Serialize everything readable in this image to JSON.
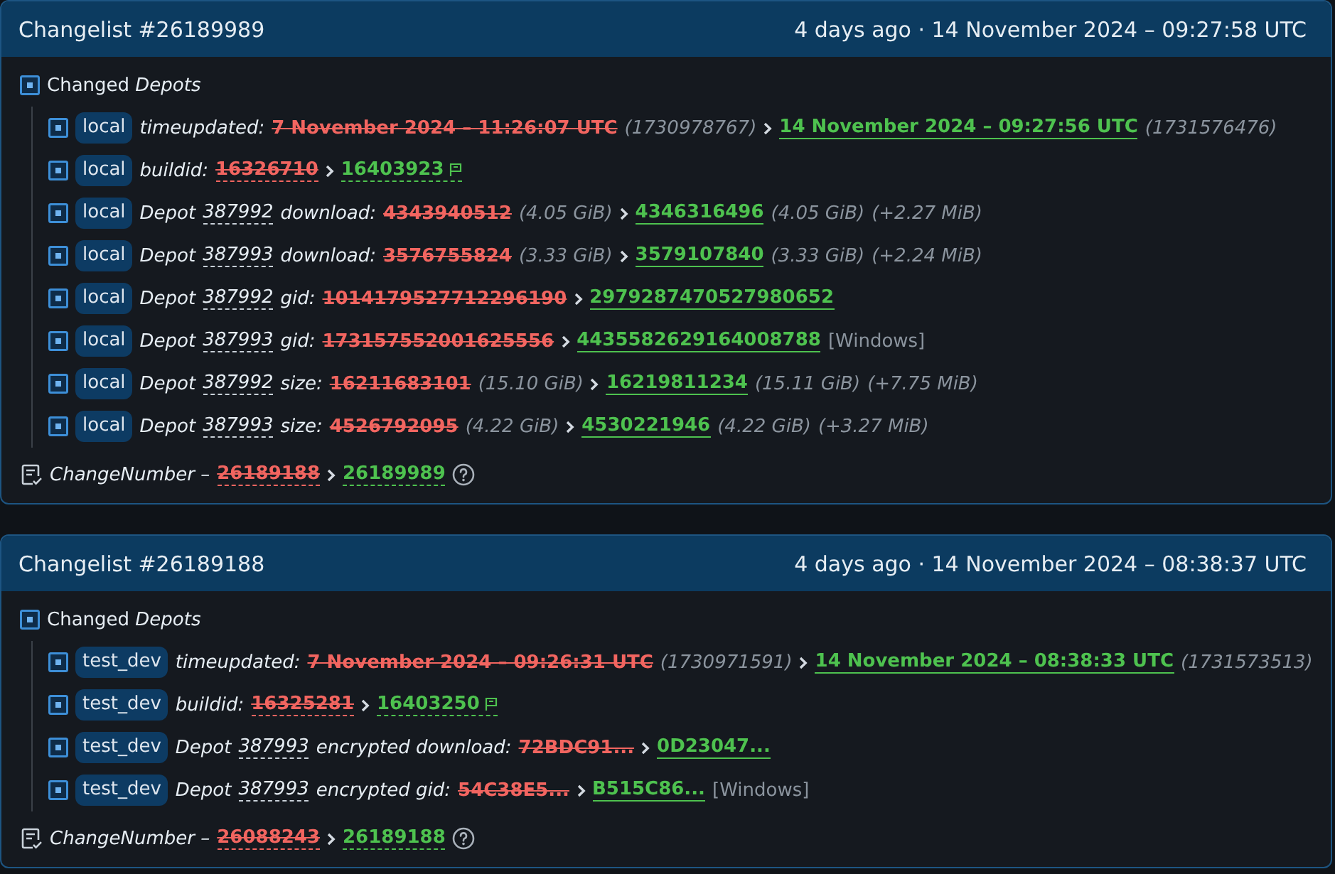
{
  "changelists": [
    {
      "title": "Changelist #26189989",
      "time": "4 days ago · 14 November 2024 – 09:27:58 UTC",
      "group": "Changed *Depots*",
      "entries": [
        {
          "kind": "link",
          "tag": "local",
          "key": "timeupdated:",
          "old": "7 November 2024 – 11:26:07 UTC",
          "old_note": "(1730978767)",
          "new": "14 November 2024 – 09:27:56 UTC",
          "new_note": "(1731576476)"
        },
        {
          "kind": "build",
          "tag": "local",
          "key": "buildid:",
          "old": "16326710",
          "new": "16403923"
        },
        {
          "kind": "link",
          "tag": "local",
          "prefix": "Depot",
          "depot": "387992",
          "key": "download:",
          "old": "4343940512",
          "old_note": "(4.05 GiB)",
          "new": "4346316496",
          "new_note": "(4.05 GiB)",
          "diff": "(+2.27 MiB)"
        },
        {
          "kind": "link",
          "tag": "local",
          "prefix": "Depot",
          "depot": "387993",
          "key": "download:",
          "old": "3576755824",
          "old_note": "(3.33 GiB)",
          "new": "3579107840",
          "new_note": "(3.33 GiB)",
          "diff": "(+2.24 MiB)"
        },
        {
          "kind": "link",
          "tag": "local",
          "prefix": "Depot",
          "depot": "387992",
          "key": "gid:",
          "old": "1014179527712296190",
          "new": "2979287470527980652"
        },
        {
          "kind": "link",
          "tag": "local",
          "prefix": "Depot",
          "depot": "387993",
          "key": "gid:",
          "old": "173157552001625556",
          "new": "4435582629164008788",
          "platform": "[Windows]"
        },
        {
          "kind": "link",
          "tag": "local",
          "prefix": "Depot",
          "depot": "387992",
          "key": "size:",
          "old": "16211683101",
          "old_note": "(15.10 GiB)",
          "new": "16219811234",
          "new_note": "(15.11 GiB)",
          "diff": "(+7.75 MiB)"
        },
        {
          "kind": "link",
          "tag": "local",
          "prefix": "Depot",
          "depot": "387993",
          "key": "size:",
          "old": "4526792095",
          "old_note": "(4.22 GiB)",
          "new": "4530221946",
          "new_note": "(4.22 GiB)",
          "diff": "(+3.27 MiB)"
        }
      ],
      "change_number": {
        "label": "ChangeNumber –",
        "old": "26189188",
        "new": "26189989"
      }
    },
    {
      "title": "Changelist #26189188",
      "time": "4 days ago · 14 November 2024 – 08:38:37 UTC",
      "group": "Changed *Depots*",
      "entries": [
        {
          "kind": "link",
          "tag": "test_dev",
          "key": "timeupdated:",
          "old": "7 November 2024 – 09:26:31 UTC",
          "old_note": "(1730971591)",
          "new": "14 November 2024 – 08:38:33 UTC",
          "new_note": "(1731573513)"
        },
        {
          "kind": "build",
          "tag": "test_dev",
          "key": "buildid:",
          "old": "16325281",
          "new": "16403250"
        },
        {
          "kind": "link",
          "tag": "test_dev",
          "prefix": "Depot",
          "depot": "387993",
          "key": "encrypted download:",
          "old": "72BDC91...",
          "new": "0D23047..."
        },
        {
          "kind": "link",
          "tag": "test_dev",
          "prefix": "Depot",
          "depot": "387993",
          "key": "encrypted gid:",
          "old": "54C38E5...",
          "new": "B515C86...",
          "platform": "[Windows]"
        }
      ],
      "change_number": {
        "label": "ChangeNumber –",
        "old": "26088243",
        "new": "26189188"
      }
    }
  ]
}
